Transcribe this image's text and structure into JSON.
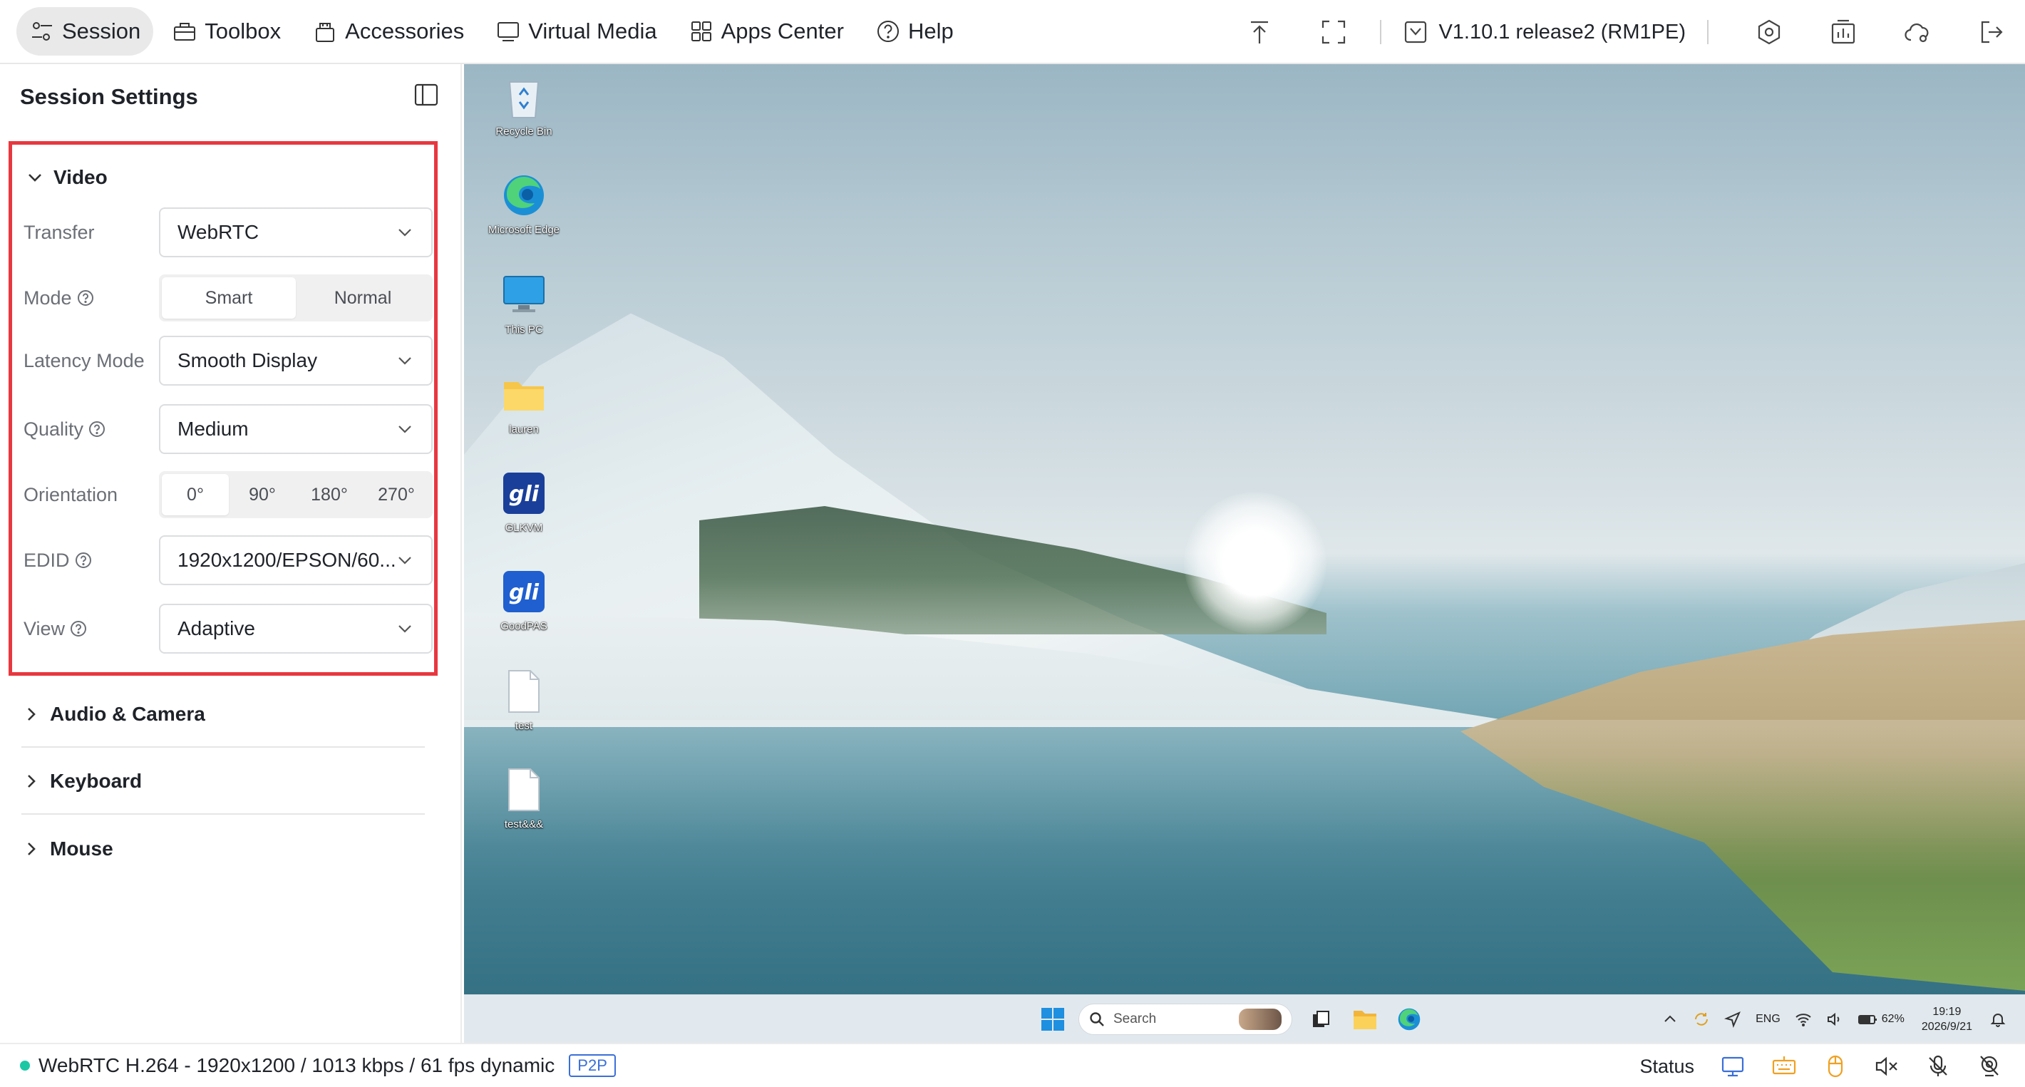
{
  "nav": {
    "session": "Session",
    "toolbox": "Toolbox",
    "accessories": "Accessories",
    "virtual_media": "Virtual Media",
    "apps_center": "Apps Center",
    "help": "Help"
  },
  "header": {
    "version": "V1.10.1 release2 (RM1PE)"
  },
  "sidebar": {
    "title": "Session Settings",
    "video": {
      "title": "Video",
      "transfer_label": "Transfer",
      "transfer_value": "WebRTC",
      "mode_label": "Mode",
      "mode_options": [
        "Smart",
        "Normal"
      ],
      "mode_selected": "Smart",
      "latency_label": "Latency Mode",
      "latency_value": "Smooth Display",
      "quality_label": "Quality",
      "quality_value": "Medium",
      "orientation_label": "Orientation",
      "orientation_options": [
        "0°",
        "90°",
        "180°",
        "270°"
      ],
      "orientation_selected": "0°",
      "edid_label": "EDID",
      "edid_value": "1920x1200/EPSON/60...",
      "view_label": "View",
      "view_value": "Adaptive"
    },
    "sections": [
      "Audio & Camera",
      "Keyboard",
      "Mouse"
    ]
  },
  "desktop": {
    "icons": [
      "Recycle Bin",
      "Microsoft Edge",
      "This PC",
      "lauren",
      "GLKVM",
      "GoodPAS",
      "test",
      "test&&&"
    ],
    "search_placeholder": "Search",
    "tray_lang": "ENG",
    "battery": "62%",
    "time": "19:19",
    "date": "2026/9/21"
  },
  "statusbar": {
    "info": "WebRTC H.264 - 1920x1200  /  1013 kbps / 61 fps dynamic",
    "p2p": "P2P",
    "status_label": "Status"
  },
  "colors": {
    "highlight_border": "#e8373f",
    "status_dot": "#1cc8a4",
    "p2p": "#3a6fd8",
    "tray_orange": "#f0a020"
  }
}
